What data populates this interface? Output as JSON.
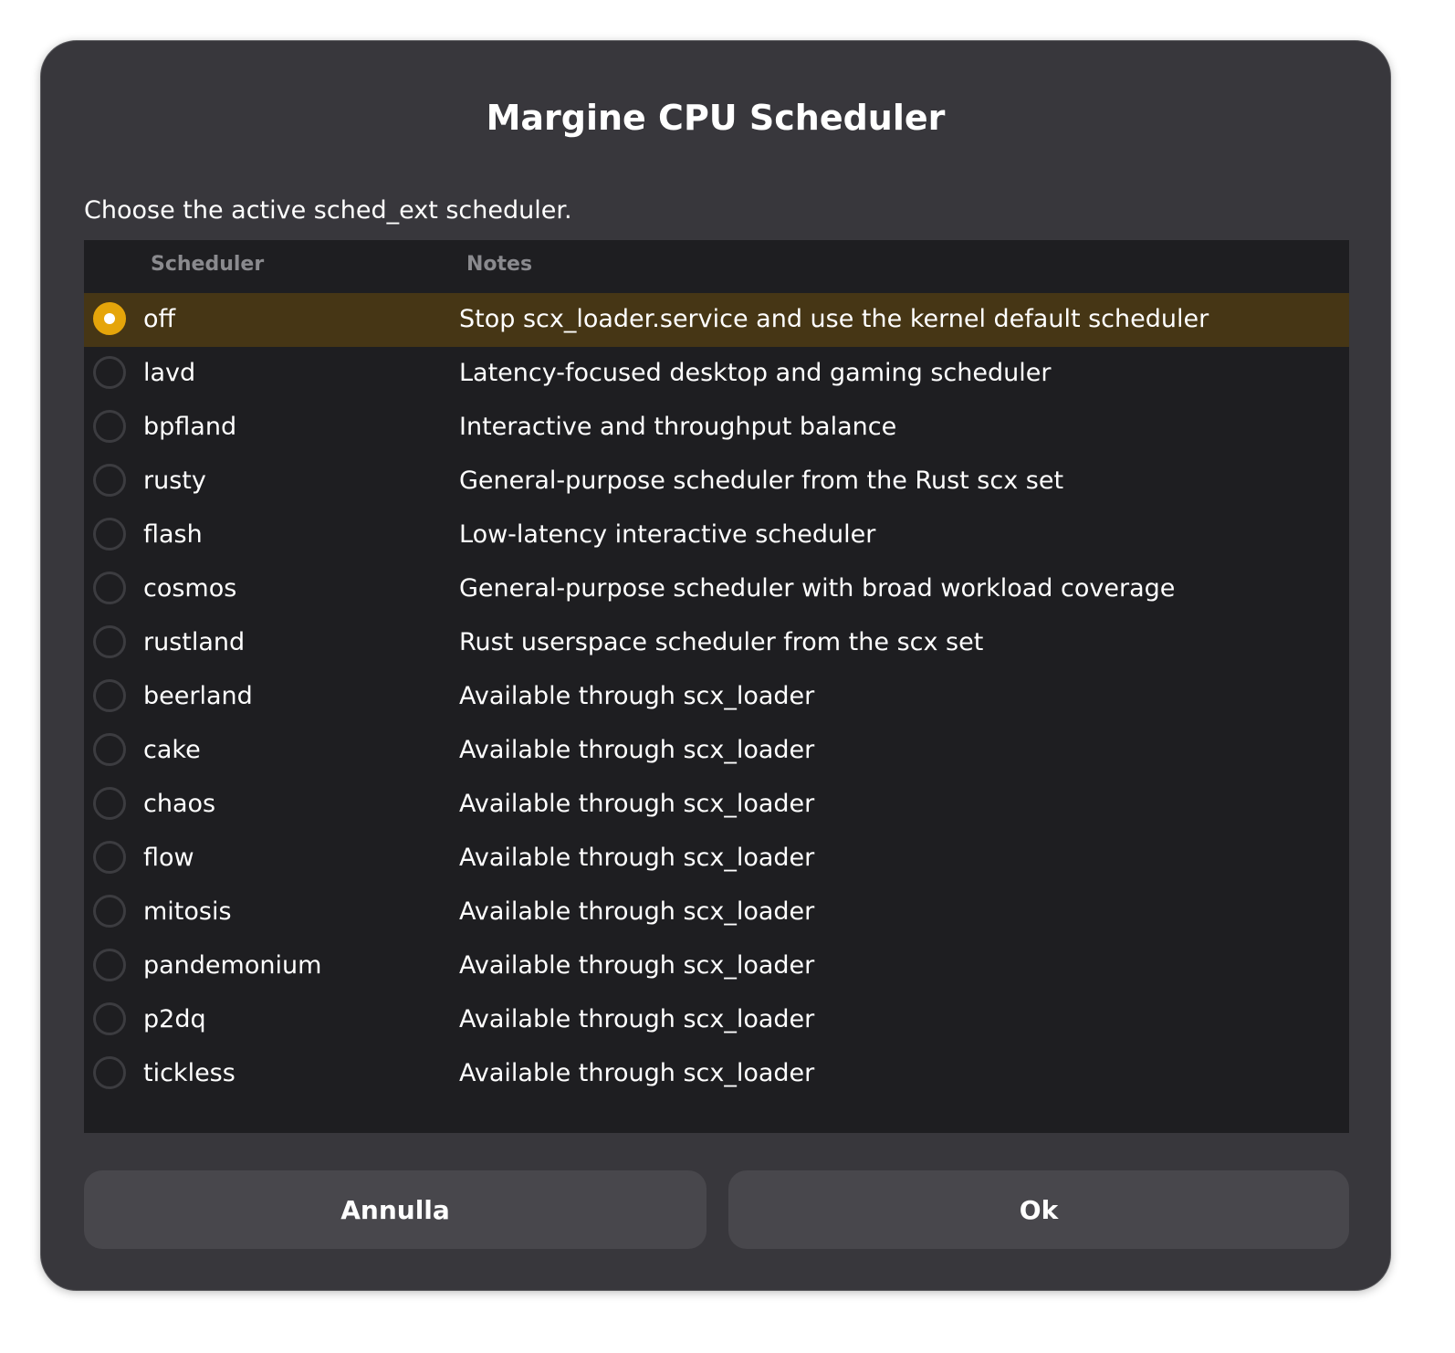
{
  "dialog": {
    "title": "Margine CPU Scheduler",
    "subtitle": "Choose the active sched_ext scheduler."
  },
  "list": {
    "columns": {
      "scheduler": "Scheduler",
      "notes": "Notes"
    },
    "selected_index": 0,
    "rows": [
      {
        "name": "off",
        "notes": "Stop scx_loader.service and use the kernel default scheduler"
      },
      {
        "name": "lavd",
        "notes": "Latency-focused desktop and gaming scheduler"
      },
      {
        "name": "bpfland",
        "notes": "Interactive and throughput balance"
      },
      {
        "name": "rusty",
        "notes": "General-purpose scheduler from the Rust scx set"
      },
      {
        "name": "flash",
        "notes": "Low-latency interactive scheduler"
      },
      {
        "name": "cosmos",
        "notes": "General-purpose scheduler with broad workload coverage"
      },
      {
        "name": "rustland",
        "notes": "Rust userspace scheduler from the scx set"
      },
      {
        "name": "beerland",
        "notes": "Available through scx_loader"
      },
      {
        "name": "cake",
        "notes": "Available through scx_loader"
      },
      {
        "name": "chaos",
        "notes": "Available through scx_loader"
      },
      {
        "name": "flow",
        "notes": "Available through scx_loader"
      },
      {
        "name": "mitosis",
        "notes": "Available through scx_loader"
      },
      {
        "name": "pandemonium",
        "notes": "Available through scx_loader"
      },
      {
        "name": "p2dq",
        "notes": "Available through scx_loader"
      },
      {
        "name": "tickless",
        "notes": "Available through scx_loader"
      }
    ]
  },
  "buttons": {
    "cancel_label": "Annulla",
    "ok_label": "Ok"
  },
  "colors": {
    "accent": "#e5a50a",
    "selected_row": "#463615",
    "dialog_bg": "#38373c",
    "list_bg": "#1e1e21",
    "button_bg": "#48474c"
  }
}
